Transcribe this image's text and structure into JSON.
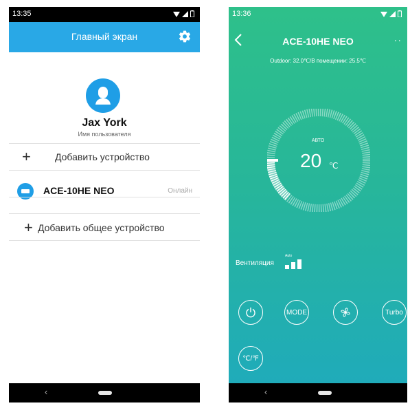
{
  "left": {
    "status_time": "13:35",
    "title": "Главный экран",
    "user_name": "Jax York",
    "user_sub": "Имя пользователя",
    "add_device": "Добавить устройство",
    "device_name": "ACE-10HE NEO",
    "device_status": "Онлайн",
    "add_shared": "Добавить общее устройство",
    "nav_back": "‹"
  },
  "right": {
    "status_time": "13:36",
    "title": "ACE-10HE NEO",
    "more": "··",
    "subtitle": "Outdoor: 32.0℃/В помещении: 25.5℃",
    "mode": "АВТО",
    "temperature": "20",
    "unit": "℃",
    "vent_label": "Вентиляция",
    "vent_auto": "Auto",
    "btn_mode": "MODE",
    "btn_turbo": "Turbo",
    "btn_unit": "℃/℉",
    "nav_back": "‹"
  },
  "colors": {
    "appbar_blue": "#29a8e6",
    "accent_blue": "#1f9ee6",
    "gradient_top": "#2ec08a",
    "gradient_bottom": "#1faabd"
  }
}
